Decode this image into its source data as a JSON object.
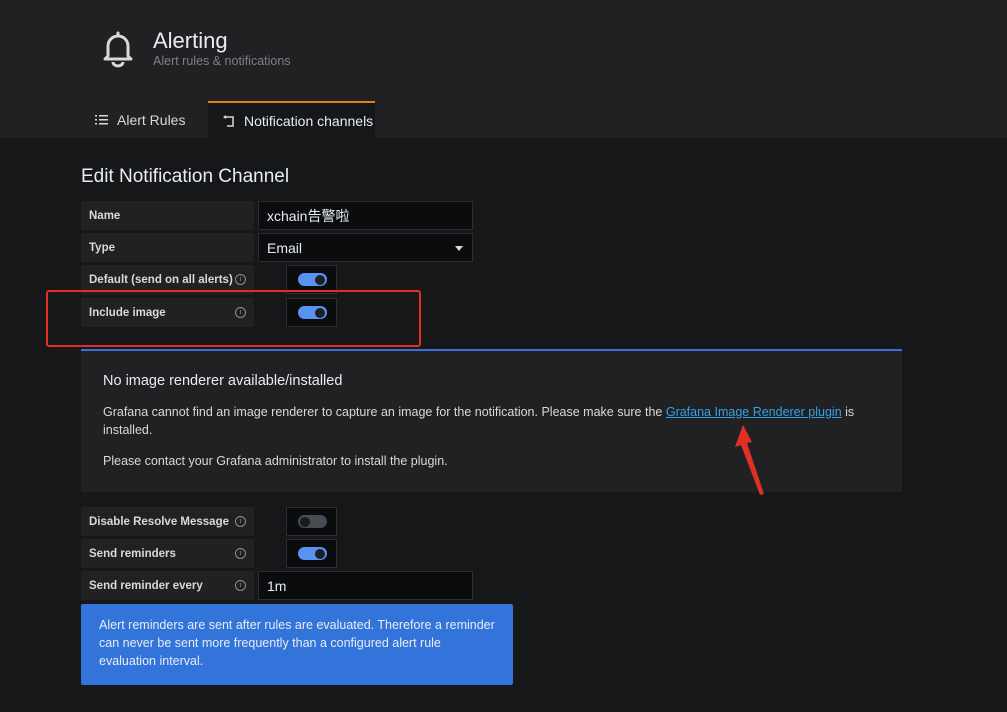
{
  "header": {
    "title": "Alerting",
    "subtitle": "Alert rules & notifications",
    "tabs": [
      {
        "label": "Alert Rules",
        "icon": "list-icon",
        "active": false
      },
      {
        "label": "Notification channels",
        "icon": "channel-icon",
        "active": true
      }
    ]
  },
  "page": {
    "heading": "Edit Notification Channel"
  },
  "form": {
    "name_label": "Name",
    "name_value": "xchain告警啦",
    "type_label": "Type",
    "type_value": "Email",
    "default_label": "Default (send on all alerts)",
    "default_on": true,
    "include_image_label": "Include image",
    "include_image_on": true,
    "disable_resolve_label": "Disable Resolve Message",
    "disable_resolve_on": false,
    "send_reminders_label": "Send reminders",
    "send_reminders_on": true,
    "reminder_every_label": "Send reminder every",
    "reminder_every_value": "1m"
  },
  "renderer_alert": {
    "title": "No image renderer available/installed",
    "body_prefix": "Grafana cannot find an image renderer to capture an image for the notification. Please make sure the ",
    "link_text": "Grafana Image Renderer plugin",
    "body_suffix": " is installed.",
    "contact": "Please contact your Grafana administrator to install the plugin."
  },
  "reminder_info": "Alert reminders are sent after rules are evaluated. Therefore a reminder can never be sent more frequently than a configured alert rule evaluation interval.",
  "colors": {
    "accent": "#5794f2",
    "tab_border": "#eb7b18",
    "info": "#3274d9",
    "annotation": "#e02f25"
  }
}
